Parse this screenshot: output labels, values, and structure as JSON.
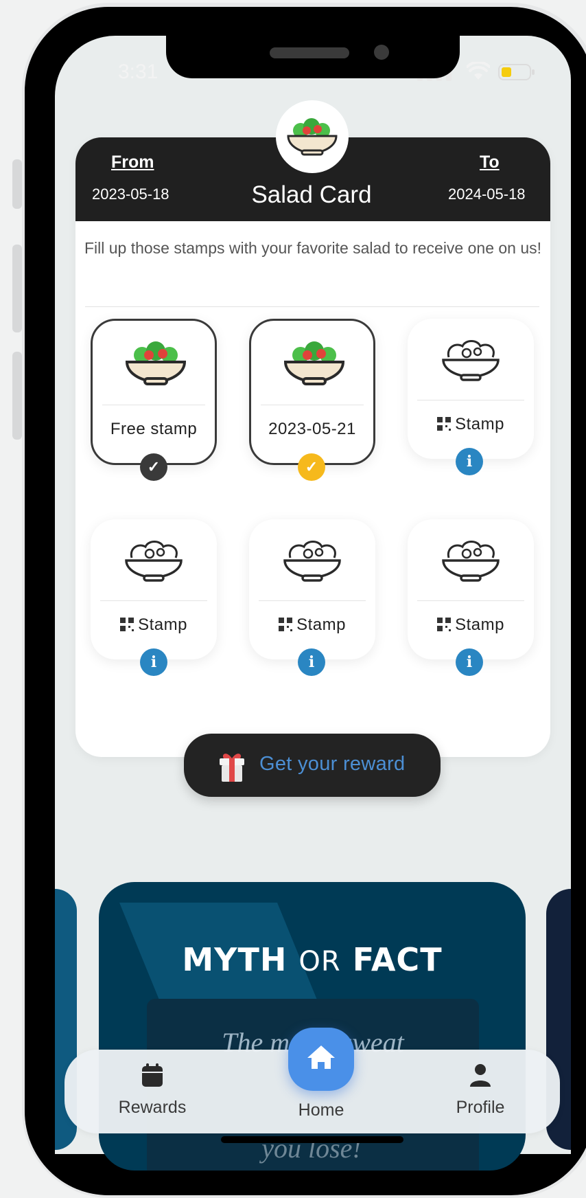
{
  "status_bar": {
    "time": "3:31"
  },
  "card": {
    "title": "Salad Card",
    "from_label": "From",
    "from_date": "2023-05-18",
    "to_label": "To",
    "to_date": "2024-05-18",
    "description": "Fill up those stamps with your favorite salad to receive one on us!"
  },
  "stamps": [
    {
      "label": "Free stamp",
      "state": "done",
      "badge_icon": "check-icon",
      "badge_color": "#3a3a3a"
    },
    {
      "label": "2023-05-21",
      "state": "done",
      "badge_icon": "check-icon",
      "badge_color": "#f6b91c"
    },
    {
      "label": "Stamp",
      "state": "pending",
      "badge_icon": "info-icon",
      "badge_color": "#2a86c2"
    },
    {
      "label": "Stamp",
      "state": "pending",
      "badge_icon": "info-icon",
      "badge_color": "#2a86c2"
    },
    {
      "label": "Stamp",
      "state": "pending",
      "badge_icon": "info-icon",
      "badge_color": "#2a86c2"
    },
    {
      "label": "Stamp",
      "state": "pending",
      "badge_icon": "info-icon",
      "badge_color": "#2a86c2"
    }
  ],
  "reward_button": {
    "label": "Get your reward",
    "icon": "gift-icon"
  },
  "carousel": {
    "title_myth": "MYTH",
    "title_or": "OR",
    "title_fact": "FACT",
    "quote_line1": "The mor   u sweat",
    "quote_line2": "you lose!"
  },
  "tabs": [
    {
      "label": "Rewards",
      "icon": "calendar-icon"
    },
    {
      "label": "Home",
      "icon": "home-icon",
      "active": true
    },
    {
      "label": "Profile",
      "icon": "user-icon"
    }
  ],
  "colors": {
    "accent_blue": "#4a90e8",
    "check_yellow": "#f6b91c",
    "info_blue": "#2a86c2",
    "card_header": "#202020"
  }
}
